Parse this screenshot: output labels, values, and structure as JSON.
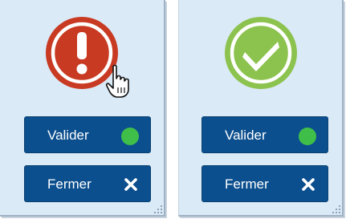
{
  "colors": {
    "error": "#c83a22",
    "success": "#8cc24e",
    "button_bg": "#0c4f8e",
    "status_dot": "#3fbf4a"
  },
  "dialogs": [
    {
      "status_icon": "error-exclamation-icon",
      "status_color": "#c83a22",
      "validate_label": "Valider",
      "validate_icon": "green-status-dot-icon",
      "close_label": "Fermer",
      "close_icon": "close-x-icon"
    },
    {
      "status_icon": "success-check-icon",
      "status_color": "#8cc24e",
      "validate_label": "Valider",
      "validate_icon": "green-status-dot-icon",
      "close_label": "Fermer",
      "close_icon": "close-x-icon"
    }
  ],
  "cursor": "hand-pointer-icon"
}
